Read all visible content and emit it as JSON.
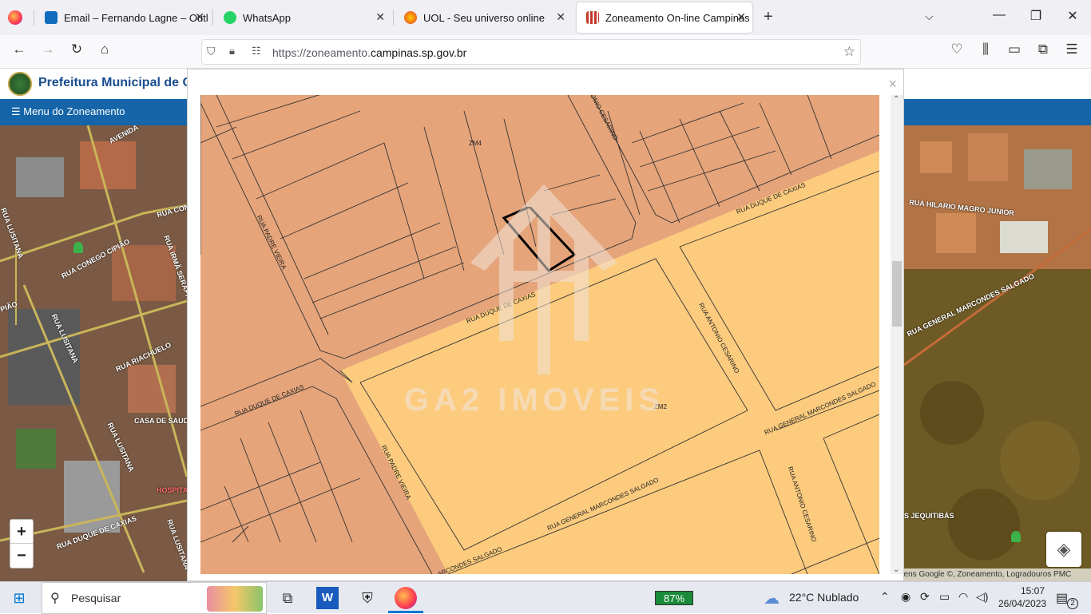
{
  "tabs": [
    {
      "title": "Email – Fernando Lagne – Outlo",
      "icon": "outlook-icon",
      "color": "#0f6cbd"
    },
    {
      "title": "WhatsApp",
      "icon": "whatsapp-icon",
      "color": "#25d366"
    },
    {
      "title": "UOL - Seu universo online",
      "icon": "uol-icon",
      "color": "#f5a623"
    },
    {
      "title": "Zoneamento On-line Campinas",
      "icon": "campinas-icon",
      "color": "#c0392b"
    }
  ],
  "url": {
    "prefix": "https://zoneamento.",
    "domain": "campinas.sp.gov.br"
  },
  "site": {
    "title": "Prefeitura Municipal de C",
    "menu": "☰ Menu do Zoneamento"
  },
  "modal": {
    "close": "×"
  },
  "map": {
    "zones": [
      "ZM4",
      "ZM2"
    ],
    "streets": [
      "RUA ANTONIO CESARINO",
      "RUA DUQUE DE CAXIAS",
      "RUA PADRE VIEIRA",
      "RUA DUQUE DE CAXIAS",
      "RUA DUQUE DE CAXIAS",
      "RUA PADRE VIEIRA",
      "RUA ANTONIO CESARINO",
      "RUA GENERAL MARCONDES SALGADO",
      "RUA ANTONIO CESARINO",
      "RUA GENERAL MARCONDES SALGADO",
      "ARCONDES SALGADO"
    ],
    "watermark": "GA2 IMOVEIS",
    "colors": {
      "zm4": "#e6a47a",
      "zm2": "#fccb7e"
    }
  },
  "satellite_left": {
    "labels": [
      "AVENIDA",
      "RUA CON",
      "RUA CONEGO CIPIÃO",
      "RUA IRMÃ SERAPHINA",
      "RUA LUSITANA",
      "PIÃO",
      "RUA LUSITANA",
      "RUA RIACHUELO",
      "CASA DE SAUDE",
      "RUA LUSITANA",
      "HOSPITAL",
      "RUA DUQUE DE CAXIAS",
      "RUA LUSITANA"
    ]
  },
  "satellite_right": {
    "labels": [
      "RUA HILARIO MAGRO JUNIOR",
      "RUA GENERAL MARCONDES SALGADO",
      "S JEQUITIBÁS"
    ]
  },
  "zoom": {
    "in": "+",
    "out": "−"
  },
  "attribution": "gens Google ©, Zoneamento, Logradouros PMC",
  "taskbar": {
    "search": "Pesquisar",
    "battery": "87%",
    "weather": "22°C  Nublado",
    "time": "15:07",
    "date": "26/04/2023",
    "notifications": "2"
  }
}
